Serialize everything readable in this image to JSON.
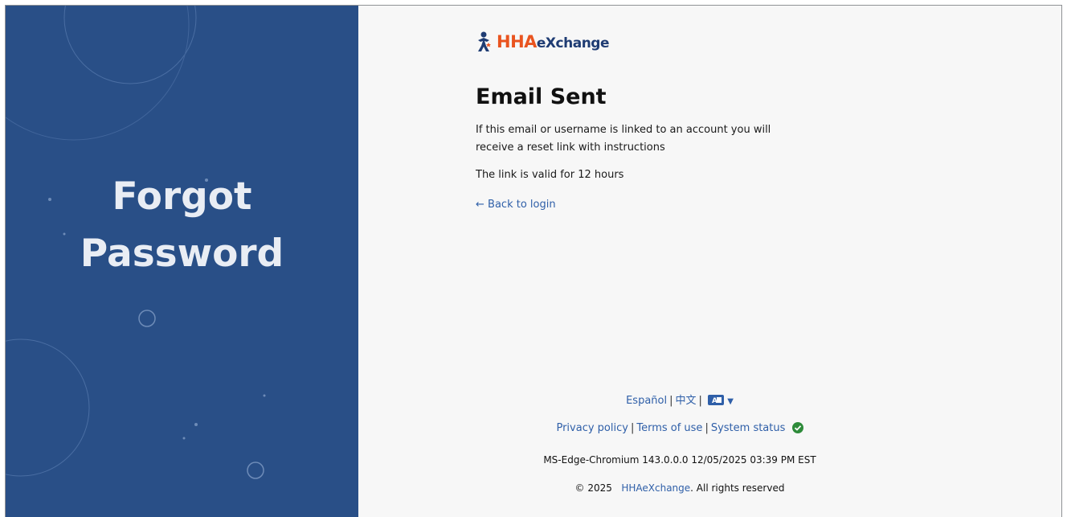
{
  "left_panel": {
    "title_line1": "Forgot",
    "title_line2": "Password",
    "background_color": "#294f87"
  },
  "logo": {
    "brand_hha": "HHA",
    "brand_exchange": "eXchange",
    "icon": "person-star-icon"
  },
  "content": {
    "heading": "Email Sent",
    "message": "If this email or username is linked to an account you will receive a reset link with instructions",
    "validity": "The link is valid for 12 hours",
    "back_link": "Back to login"
  },
  "footer": {
    "languages": [
      "Español",
      "中文"
    ],
    "language_icon": "translate-icon",
    "privacy": "Privacy policy",
    "terms": "Terms of use",
    "status": "System status",
    "status_icon": "check-circle-icon",
    "status_color": "#2e8b3a",
    "version": "MS-Edge-Chromium 143.0.0.0  12/05/2025 03:39 PM EST",
    "copyright_prefix": "© 2025",
    "copyright_brand": "HHAeXchange",
    "copyright_suffix": ". All rights reserved"
  },
  "colors": {
    "link": "#2f5fa8",
    "brand_orange": "#e9541f",
    "brand_navy": "#1f3c73"
  }
}
